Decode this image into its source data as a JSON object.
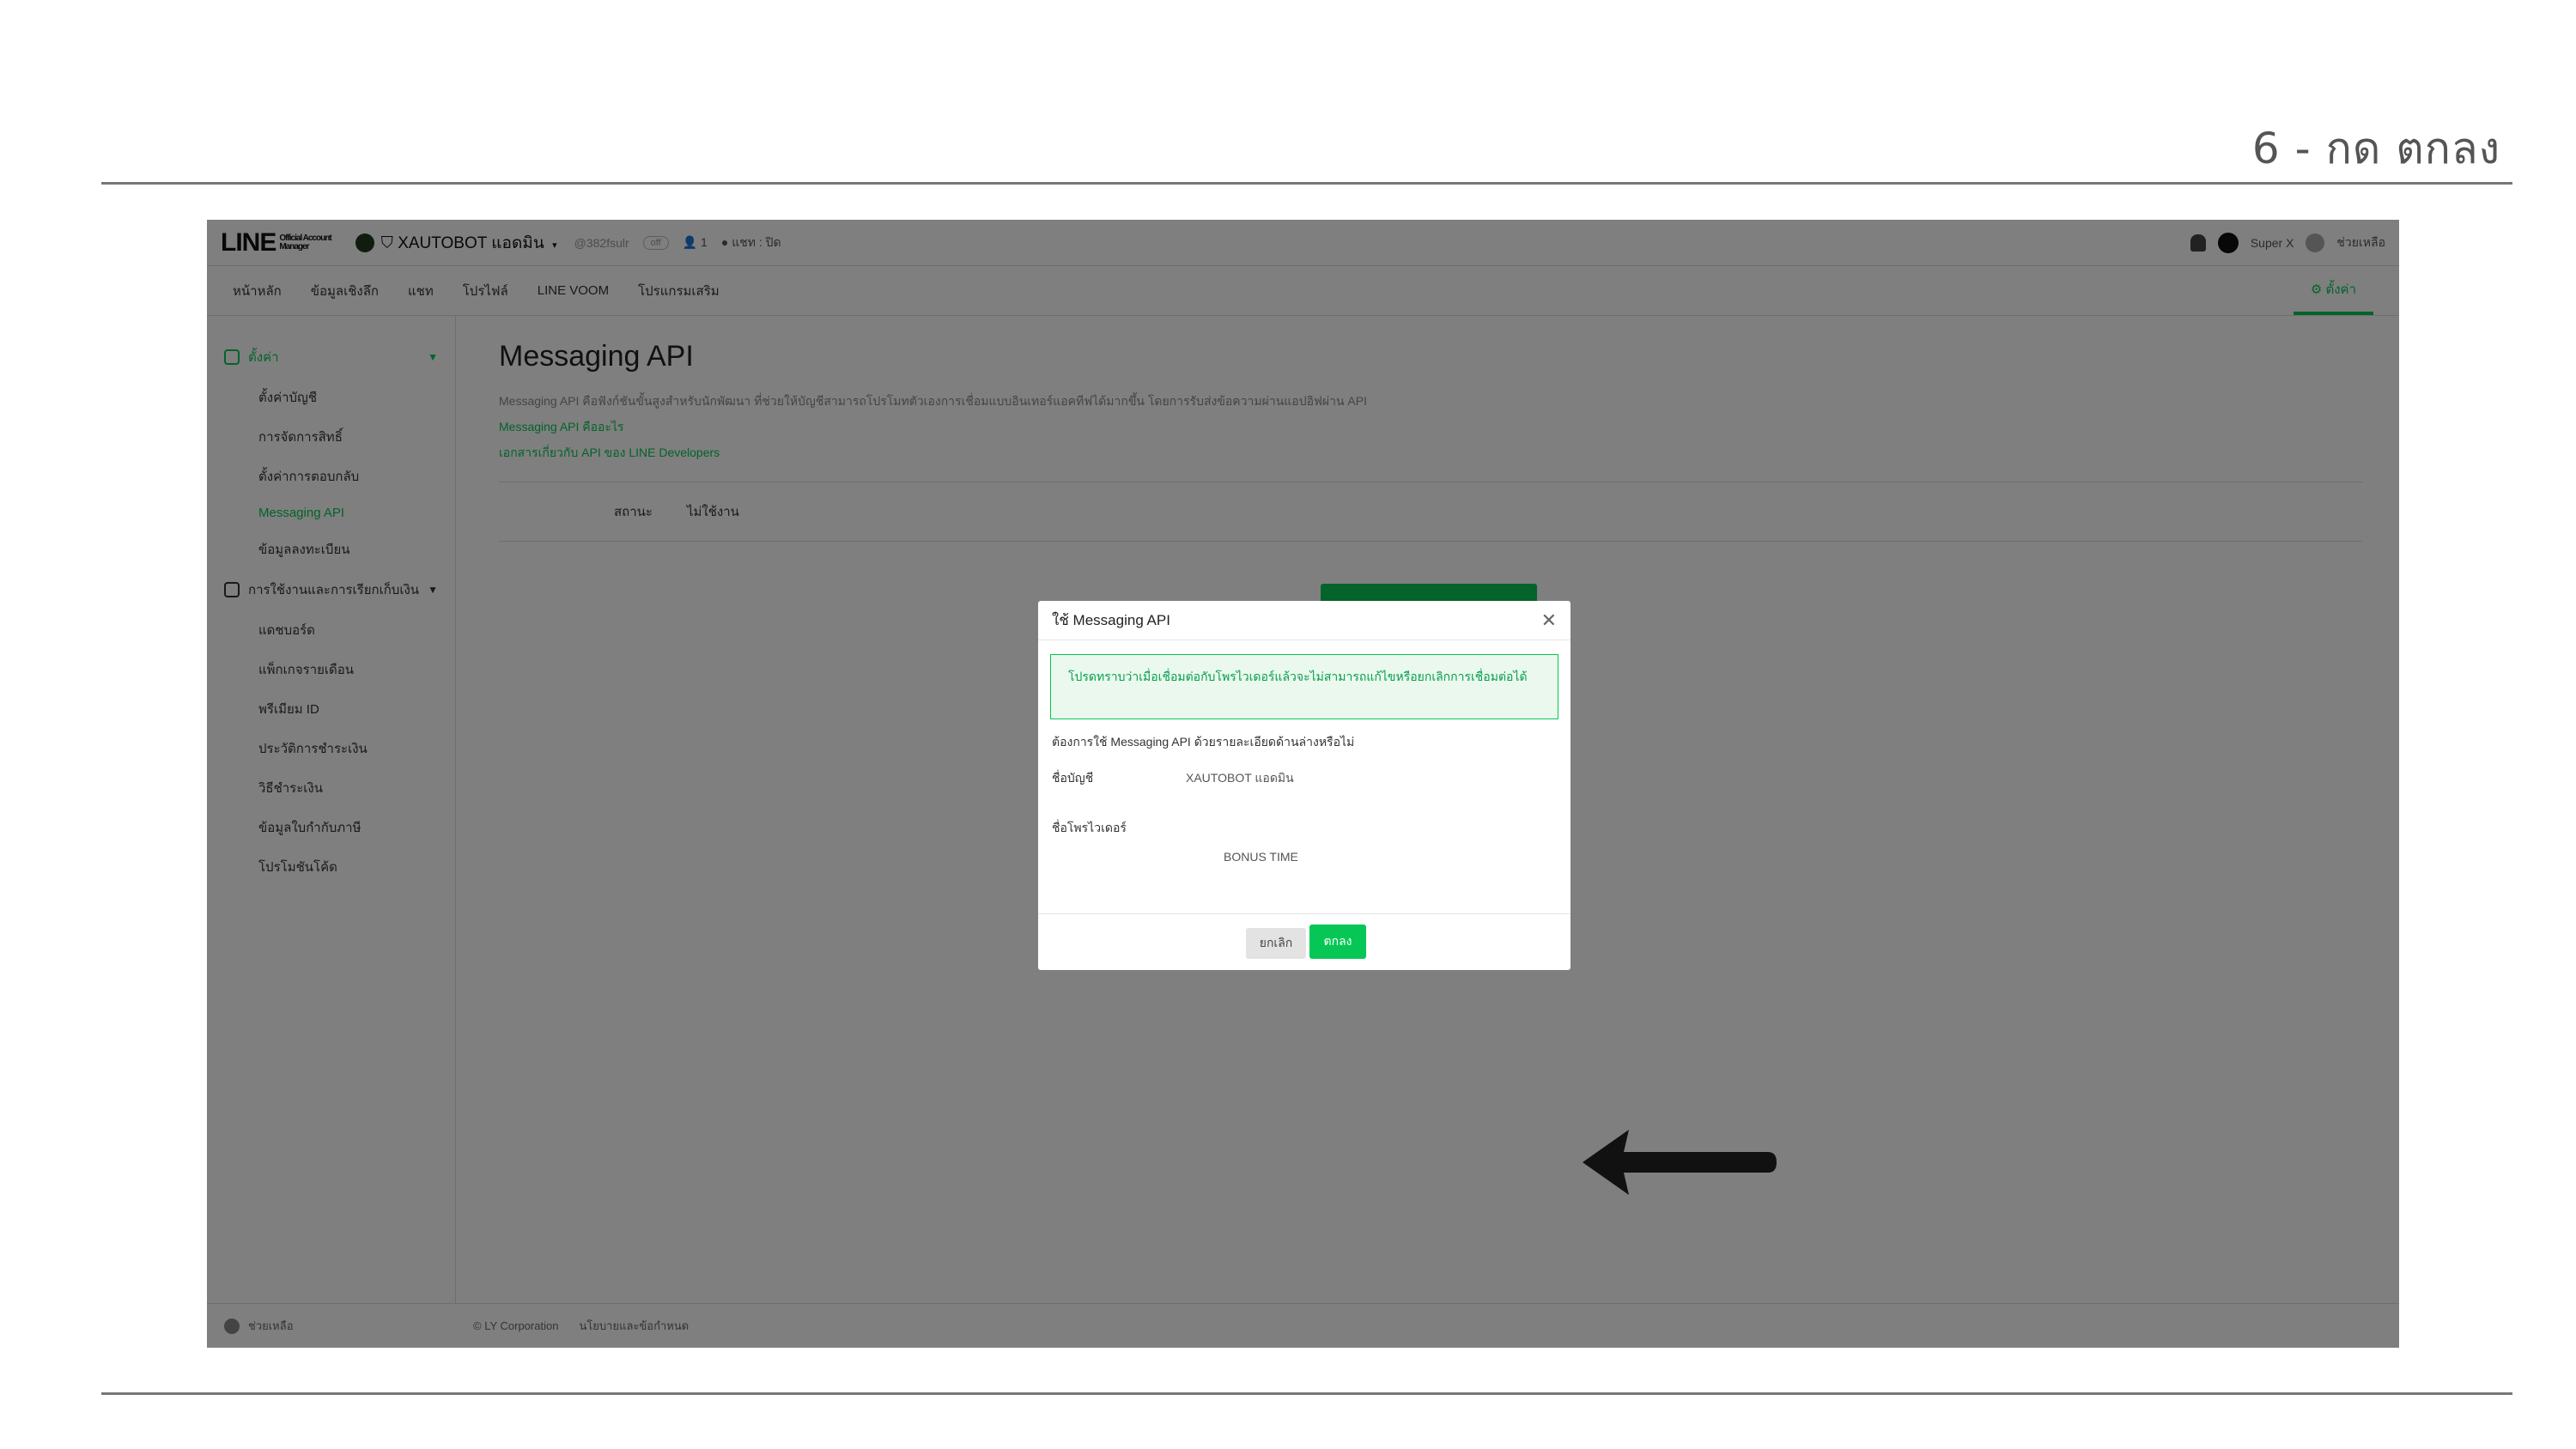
{
  "slide": {
    "step_title": "6 - กด ตกลง"
  },
  "topbar": {
    "logo": "LINE",
    "logo_sub_1": "Official Account",
    "logo_sub_2": "Manager",
    "account_name": "XAUTOBOT แอดมิน",
    "account_id": "@382fsulr",
    "badge": "off",
    "members": "1",
    "chat_status": "แชท : ปิด",
    "user_name": "Super X",
    "help_label": "ช่วยเหลือ"
  },
  "nav": {
    "items": [
      "หน้าหลัก",
      "ข้อมูลเชิงลึก",
      "แชท",
      "โปรไฟล์",
      "LINE VOOM",
      "โปรแกรมเสริม"
    ],
    "settings": "ตั้งค่า"
  },
  "sidebar": {
    "group1": "ตั้งค่า",
    "group1_items": [
      "ตั้งค่าบัญชี",
      "การจัดการสิทธิ์",
      "ตั้งค่าการตอบกลับ",
      "Messaging API",
      "ข้อมูลลงทะเบียน"
    ],
    "active_item_index": 3,
    "group2": "การใช้งานและการเรียกเก็บเงิน",
    "group2_items": [
      "แดชบอร์ด",
      "แพ็กเกจรายเดือน",
      "พรีเมียม ID",
      "ประวัติการชำระเงิน",
      "วิธีชำระเงิน",
      "ข้อมูลใบกำกับภาษี",
      "โปรโมชันโค้ด"
    ]
  },
  "main": {
    "title": "Messaging API",
    "description": "Messaging API คือฟังก์ชันขั้นสูงสำหรับนักพัฒนา ที่ช่วยให้บัญชีสามารถโปรโมทตัวเองการเชื่อมแบบอินเทอร์แอคทีฟได้มากขึ้น โดยการรับส่งข้อความผ่านแอปอิฟผ่าน API",
    "link1": "Messaging API คืออะไร",
    "link2": "เอกสารเกี่ยวกับ API ของ LINE Developers",
    "status_label": "สถานะ",
    "status_value": "ไม่ใช้งาน"
  },
  "footer": {
    "left": "ช่วยเหลือ",
    "copyright": "© LY Corporation",
    "policy": "นโยบายและข้อกำหนด"
  },
  "modal": {
    "title": "ใช้ Messaging API",
    "close_icon": "close-icon",
    "alert": "โปรดทราบว่าเมื่อเชื่อมต่อกับโพรไวเดอร์แล้วจะไม่สามารถแก้ไขหรือยกเลิกการเชื่อมต่อได้",
    "question": "ต้องการใช้ Messaging API ด้วยรายละเอียดด้านล่างหรือไม่",
    "account_label": "ชื่อบัญชี",
    "account_value": "XAUTOBOT แอดมิน",
    "provider_label": "ชื่อโพรไวเดอร์",
    "provider_value": "BONUS TIME",
    "cancel": "ยกเลิก",
    "ok": "ตกลง"
  },
  "colors": {
    "line_green": "#06c755",
    "overlay": "rgba(0,0,0,0.5)",
    "arrow": "#111111"
  }
}
